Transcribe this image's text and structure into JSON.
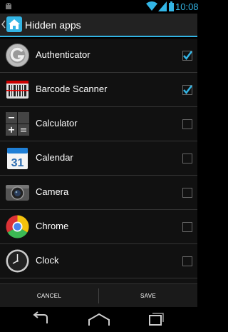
{
  "status_bar": {
    "time": "10:08",
    "icons": [
      "android-icon",
      "wifi-icon",
      "signal-icon",
      "battery-icon"
    ]
  },
  "action_bar": {
    "title": "Hidden apps",
    "up_icon": "chevron-left-icon",
    "app_icon": "home-icon"
  },
  "apps": [
    {
      "label": "Authenticator",
      "icon": "authenticator-icon",
      "checked": true
    },
    {
      "label": "Barcode Scanner",
      "icon": "barcode-scanner-icon",
      "checked": true
    },
    {
      "label": "Calculator",
      "icon": "calculator-icon",
      "checked": false
    },
    {
      "label": "Calendar",
      "icon": "calendar-icon",
      "checked": false,
      "icon_text": "31"
    },
    {
      "label": "Camera",
      "icon": "camera-icon",
      "checked": false
    },
    {
      "label": "Chrome",
      "icon": "chrome-icon",
      "checked": false
    },
    {
      "label": "Clock",
      "icon": "clock-icon",
      "checked": false
    }
  ],
  "buttons": {
    "cancel": "CANCEL",
    "save": "SAVE"
  },
  "nav": {
    "icons": [
      "back-icon",
      "home-nav-icon",
      "recent-apps-icon"
    ]
  },
  "colors": {
    "accent": "#33b5e5",
    "background": "#111111",
    "action_bar": "#222222"
  }
}
